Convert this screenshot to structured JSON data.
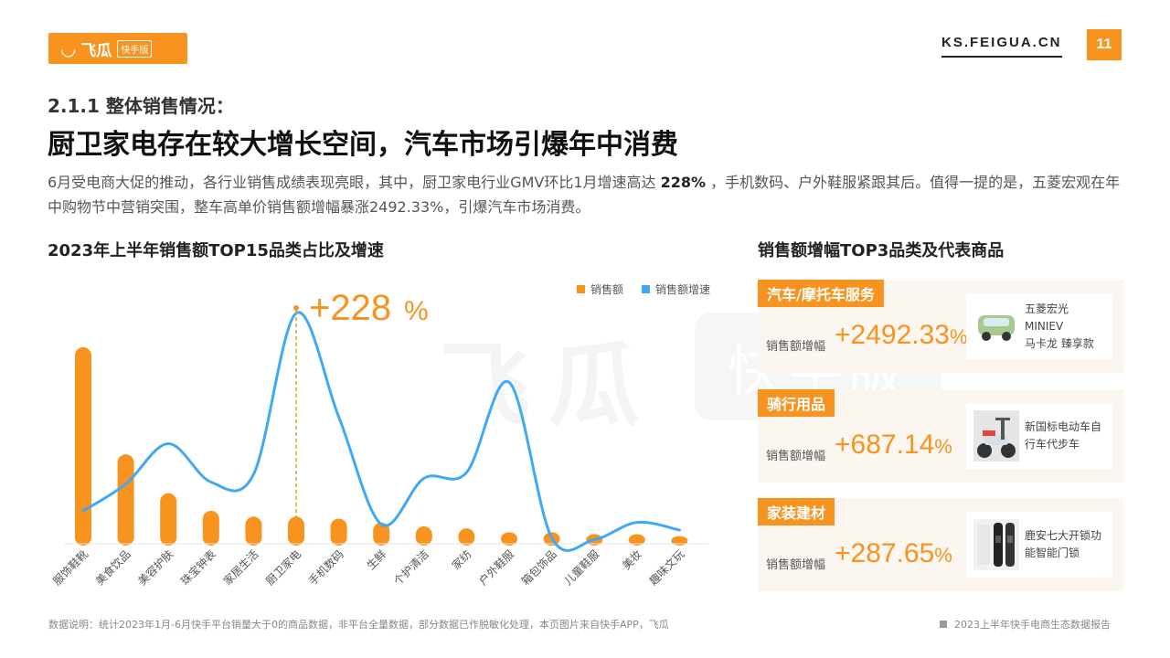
{
  "header": {
    "logo_text": "飞瓜",
    "logo_badge": "快手版",
    "site": "KS.FEIGUA.CN",
    "page_number": "11"
  },
  "section_title": "2.1.1 整体销售情况：",
  "headline": "厨卫家电存在较大增长空间，汽车市场引爆年中消费",
  "description": {
    "part1": "6月受电商大促的推动，各行业销售成绩表现亮眼，其中，厨卫家电行业GMV环比1月增速高达 ",
    "highlight": "228%",
    "part2": " ，手机数码、户外鞋服紧跟其后。值得一提的是，五菱宏观在年中购物节中营销突围，整车高单价销售额增幅暴涨2492.33%，引爆汽车市场消费。"
  },
  "chart_data": {
    "type": "bar",
    "title": "2023年上半年销售额TOP15品类占比及增速",
    "categories": [
      "服饰鞋靴",
      "美食饮品",
      "美容护肤",
      "珠宝钟表",
      "家居生活",
      "厨卫家电",
      "手机数码",
      "生鲜",
      "个护清洁",
      "家纺",
      "户外鞋服",
      "箱包饰品",
      "儿童鞋服",
      "美妆",
      "趣味文玩"
    ],
    "series": [
      {
        "name": "销售额",
        "color": "#f7931e",
        "values": [
          100,
          45,
          25,
          16,
          13,
          13,
          12,
          10,
          8,
          7,
          5,
          5,
          4,
          4,
          3
        ]
      },
      {
        "name": "销售额增速",
        "color": "#3fa9f5",
        "values": [
          10,
          24,
          45,
          25,
          29,
          113,
          59,
          3,
          27,
          30,
          77,
          -4,
          -5,
          4,
          0
        ]
      }
    ],
    "annotation": {
      "text": "+228",
      "unit": "%",
      "category": "厨卫家电"
    }
  },
  "watermark": {
    "brand": "飞瓜",
    "badge": "快手版"
  },
  "top3": {
    "title": "销售额增幅TOP3品类及代表商品",
    "metric_label": "销售额增幅",
    "items": [
      {
        "category": "汽车/摩托车服务",
        "value": "+2492.33",
        "unit": "%",
        "product_line1": "五菱宏光MINIEV",
        "product_line2": "马卡龙 臻享款",
        "thumb_icon": "car-icon"
      },
      {
        "category": "骑行用品",
        "value": "+687.14",
        "unit": "%",
        "product_line1": "新国标电动车自",
        "product_line2": "行车代步车",
        "thumb_icon": "scooter-icon"
      },
      {
        "category": "家装建材",
        "value": "+287.65",
        "unit": "%",
        "product_line1": "鹿安七大开锁功",
        "product_line2": "能智能门锁",
        "thumb_icon": "smart-lock-icon"
      }
    ]
  },
  "footer": {
    "note": "数据说明：统计2023年1月-6月快手平台销量大于0的商品数据，非平台全量数据，部分数据已作脱敏化处理，本页图片来自快手APP，飞瓜",
    "report": "2023上半年快手电商生态数据报告"
  }
}
